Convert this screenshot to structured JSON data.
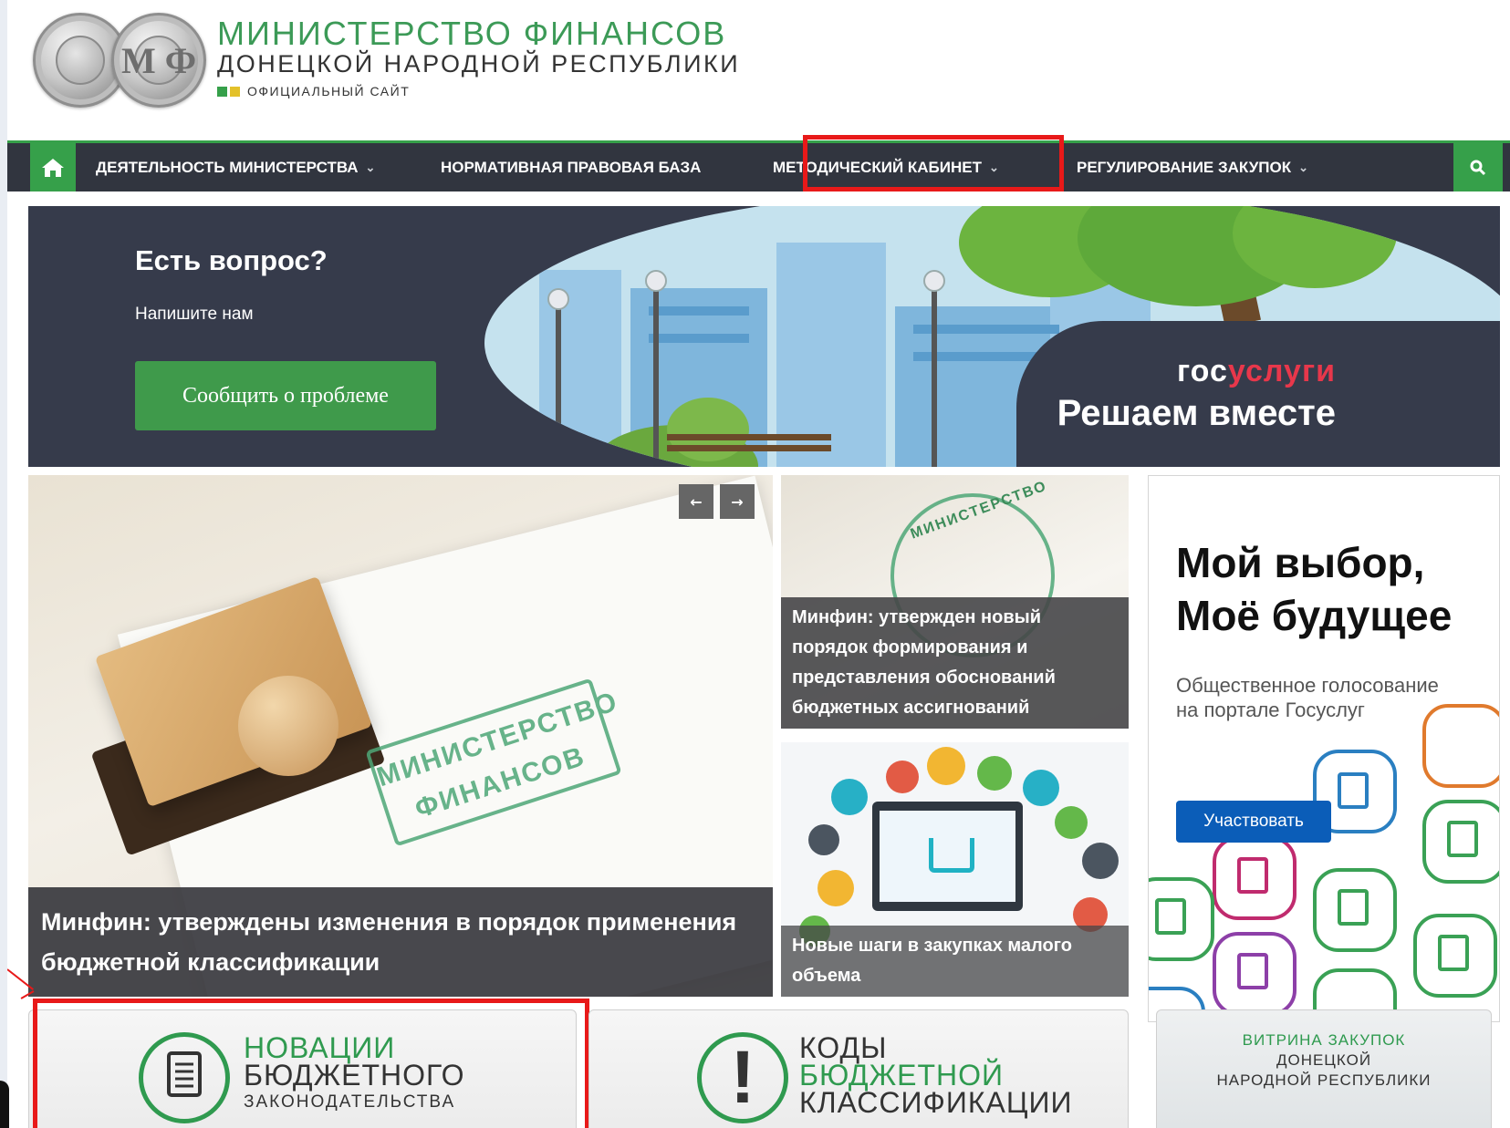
{
  "header": {
    "title": "МИНИСТЕРСТВО ФИНАНСОВ",
    "subtitle": "ДОНЕЦКОЙ НАРОДНОЙ РЕСПУБЛИКИ",
    "tagline": "ОФИЦИАЛЬНЫЙ САЙТ",
    "logo_letters": "М Ф"
  },
  "nav": {
    "items": [
      {
        "label": "ДЕЯТЕЛЬНОСТЬ МИНИСТЕРСТВА",
        "has_dropdown": true
      },
      {
        "label": "НОРМАТИВНАЯ ПРАВОВАЯ БАЗА",
        "has_dropdown": false
      },
      {
        "label": "МЕТОДИЧЕСКИЙ КАБИНЕТ",
        "has_dropdown": true
      },
      {
        "label": "РЕГУЛИРОВАНИЕ ЗАКУПОК",
        "has_dropdown": true
      }
    ],
    "home_icon": "home-icon",
    "search_icon": "search-icon",
    "chevron": "⌄"
  },
  "banner": {
    "question": "Есть вопрос?",
    "write": "Напишите нам",
    "button": "Сообщить о проблеме",
    "gos_part1": "гос",
    "gos_part2": "услуги",
    "slogan": "Решаем вместе"
  },
  "news": {
    "main_caption": "Минфин: утверждены изменения в порядок применения бюджетной классификации",
    "main_image_text": "МИНИСТЕРСТВО ФИНАНСОВ",
    "prev": "←",
    "next": "→",
    "side": [
      {
        "caption": "Минфин: утвержден новый порядок формирования и представления обоснований бюджетных ассигнований",
        "image_text": "МИНИСТЕРСТВО"
      },
      {
        "caption": "Новые шаги в закупках малого объема"
      }
    ]
  },
  "ad": {
    "title_line1": "Мой выбор,",
    "title_line2": "Моё будущее",
    "description": "Общественное голосование на портале Госуслуг",
    "button": "Участвовать"
  },
  "tiles": [
    {
      "l1": "НОВАЦИИ",
      "l2": "БЮДЖЕТНОГО",
      "l3": "ЗАКОНОДАТЕЛЬСТВА"
    },
    {
      "l1": "КОДЫ",
      "l2": "БЮДЖЕТНОЙ",
      "l3": "КЛАССИФИКАЦИИ",
      "icon": "!"
    },
    {
      "l1": "ВИТРИНА ЗАКУПОК",
      "l2": "ДОНЕЦКОЙ",
      "l3": "НАРОДНОЙ РЕСПУБЛИКИ"
    }
  ],
  "colors": {
    "brand_green": "#36a04a",
    "nav_dark": "#31353f",
    "highlight_red": "#e81919",
    "gos_red": "#e8374b",
    "ad_blue": "#0b5db8"
  }
}
